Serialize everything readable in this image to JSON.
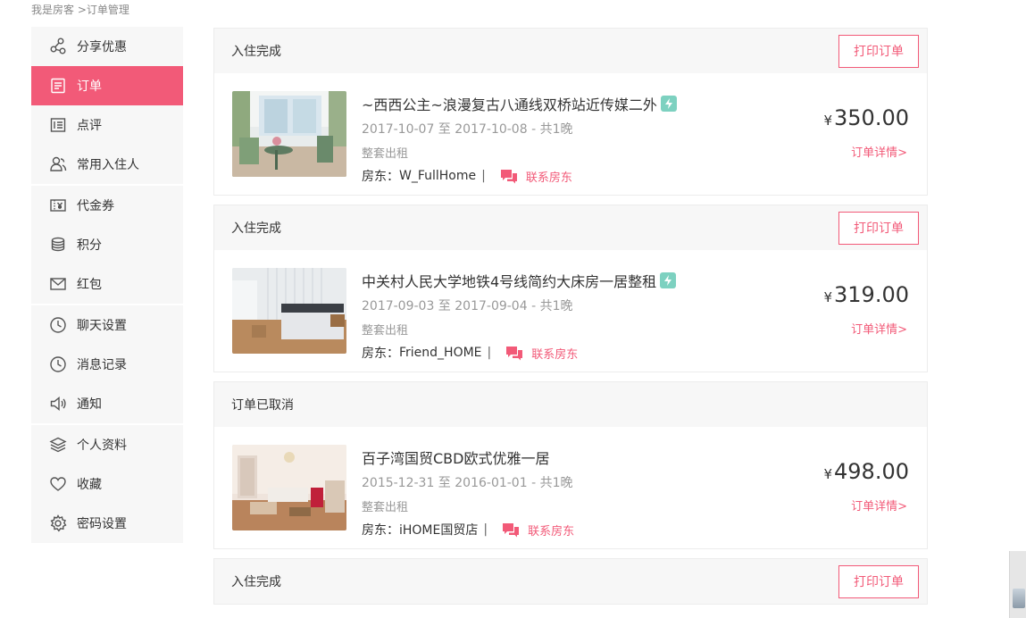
{
  "breadcrumb": {
    "home": "我是房客",
    "separator": ">",
    "current": "订单管理"
  },
  "sidebar": {
    "groups": [
      [
        {
          "label": "分享优惠",
          "icon": "share-icon"
        },
        {
          "label": "订单",
          "icon": "order-icon",
          "active": true
        },
        {
          "label": "点评",
          "icon": "review-icon"
        },
        {
          "label": "常用入住人",
          "icon": "guests-icon"
        }
      ],
      [
        {
          "label": "代金券",
          "icon": "voucher-icon"
        },
        {
          "label": "积分",
          "icon": "coins-icon"
        },
        {
          "label": "红包",
          "icon": "envelope-icon"
        }
      ],
      [
        {
          "label": "聊天设置",
          "icon": "clock-icon"
        },
        {
          "label": "消息记录",
          "icon": "clock-icon"
        },
        {
          "label": "通知",
          "icon": "speaker-icon"
        }
      ],
      [
        {
          "label": "个人资料",
          "icon": "layers-icon"
        },
        {
          "label": "收藏",
          "icon": "heart-icon"
        },
        {
          "label": "密码设置",
          "icon": "gear-icon"
        }
      ]
    ]
  },
  "orders": [
    {
      "status": "入住完成",
      "print_label": "打印订单",
      "title": "~西西公主~浪漫复古八通线双桥站近传媒二外",
      "instant": true,
      "dates": "2017-10-07 至 2017-10-08 - 共1晚",
      "type": "整套出租",
      "host_prefix": "房东：",
      "host": "W_FullHome",
      "contact_label": "联系房东",
      "currency": "¥",
      "price": "350.00",
      "detail_label": "订单详情>"
    },
    {
      "status": "入住完成",
      "print_label": "打印订单",
      "title": "中关村人民大学地铁4号线简约大床房一居整租",
      "instant": true,
      "dates": "2017-09-03 至 2017-09-04 - 共1晚",
      "type": "整套出租",
      "host_prefix": "房东：",
      "host": "Friend_HOME",
      "contact_label": "联系房东",
      "currency": "¥",
      "price": "319.00",
      "detail_label": "订单详情>"
    },
    {
      "status": "订单已取消",
      "print_label": "",
      "title": "百子湾国贸CBD欧式优雅一居",
      "instant": false,
      "dates": "2015-12-31 至 2016-01-01 - 共1晚",
      "type": "整套出租",
      "host_prefix": "房东：",
      "host": "iHOME国贸店",
      "contact_label": "联系房东",
      "currency": "¥",
      "price": "498.00",
      "detail_label": "订单详情>"
    },
    {
      "status": "入住完成",
      "print_label": "打印订单"
    }
  ],
  "colors": {
    "accent": "#f25a78",
    "instant_badge": "#7dd1c0"
  }
}
